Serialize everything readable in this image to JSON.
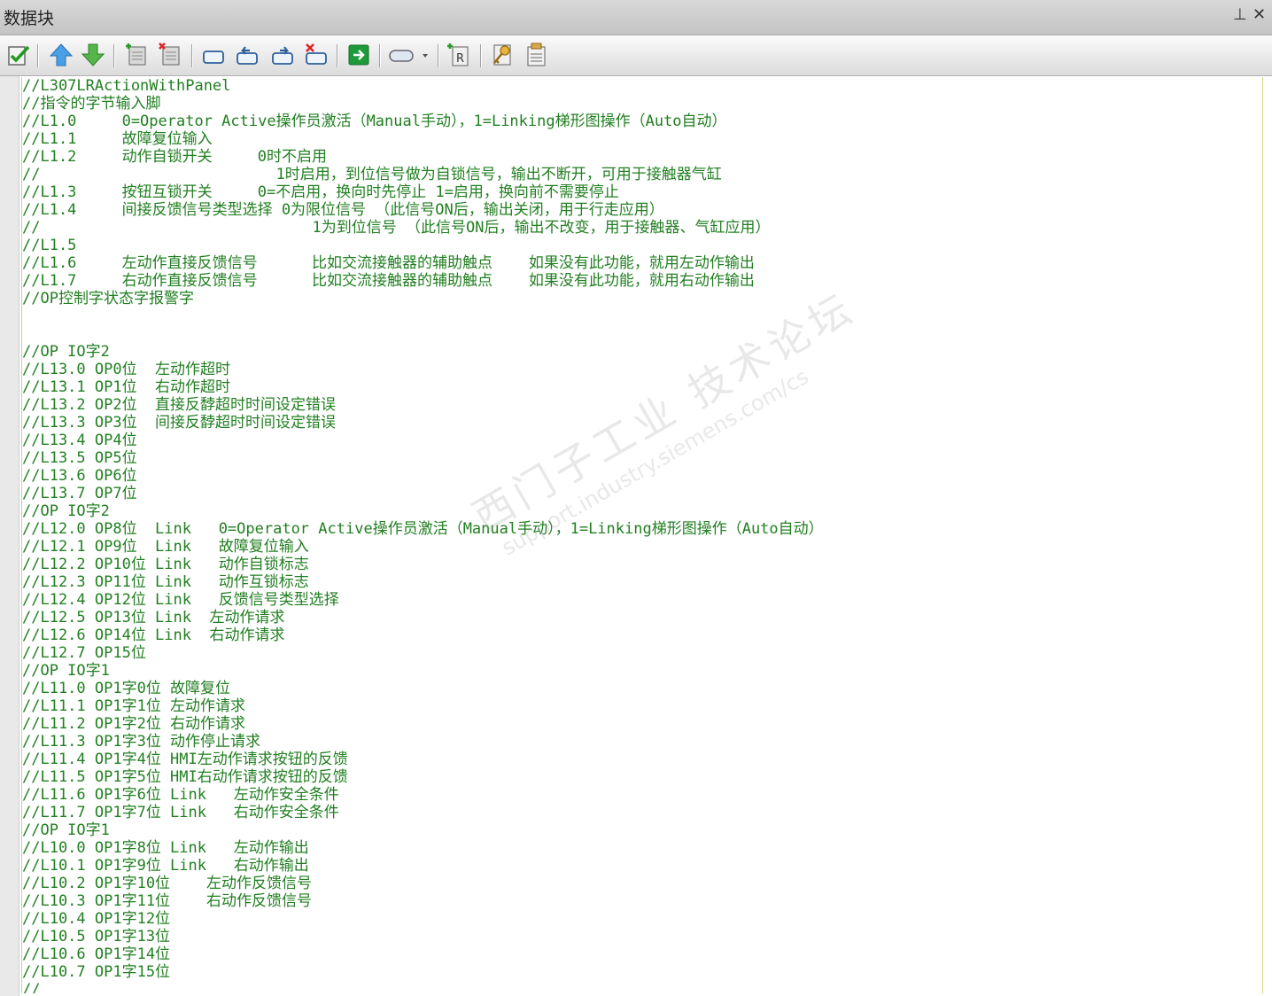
{
  "window": {
    "title": "数据块",
    "pin_glyph": "⊥",
    "close_glyph": "✕"
  },
  "toolbar": {
    "buttons": [
      "check-icon",
      "up-arrow-icon",
      "down-arrow-icon",
      "insert-block-icon",
      "delete-block-icon",
      "rectangle-icon",
      "undo-icon",
      "redo-icon",
      "delete-network-icon",
      "goto-icon",
      "comment-icon",
      "reference-icon",
      "key-icon",
      "properties-icon"
    ]
  },
  "watermark": {
    "line1": "西门子工业  技术论坛",
    "line2": "support.industry.siemens.com/cs"
  },
  "code_lines": [
    "//L307LRActionWithPanel",
    "//指令的字节输入脚",
    "//L1.0     0=Operator Active操作员激活（Manual手动），1=Linking梯形图操作（Auto自动）",
    "//L1.1     故障复位输入",
    "//L1.2     动作自锁开关     0时不启用",
    "//                          1时启用，到位信号做为自锁信号，输出不断开，可用于接触器气缸",
    "//L1.3     按钮互锁开关     0=不启用，换向时先停止 1=启用，换向前不需要停止",
    "//L1.4     间接反馈信号类型选择 0为限位信号 （此信号ON后，输出关闭，用于行走应用）",
    "//                              1为到位信号 （此信号ON后，输出不改变，用于接触器、气缸应用）",
    "//L1.5",
    "//L1.6     左动作直接反馈信号      比如交流接触器的辅助触点    如果没有此功能，就用左动作输出",
    "//L1.7     右动作直接反馈信号      比如交流接触器的辅助触点    如果没有此功能，就用右动作输出",
    "//OP控制字状态字报警字",
    "",
    "",
    "//OP IO字2",
    "//L13.0 OP0位  左动作超时",
    "//L13.1 OP1位  右动作超时",
    "//L13.2 OP2位  直接反馞超时时间设定错误",
    "//L13.3 OP3位  间接反馞超时时间设定错误",
    "//L13.4 OP4位",
    "//L13.5 OP5位",
    "//L13.6 OP6位",
    "//L13.7 OP7位",
    "//OP IO字2",
    "//L12.0 OP8位  Link   0=Operator Active操作员激活（Manual手动），1=Linking梯形图操作（Auto自动）",
    "//L12.1 OP9位  Link   故障复位输入",
    "//L12.2 OP10位 Link   动作自锁标志",
    "//L12.3 OP11位 Link   动作互锁标志",
    "//L12.4 OP12位 Link   反馈信号类型选择",
    "//L12.5 OP13位 Link  左动作请求",
    "//L12.6 OP14位 Link  右动作请求",
    "//L12.7 OP15位",
    "//OP IO字1",
    "//L11.0 OP1字0位 故障复位",
    "//L11.1 OP1字1位 左动作请求",
    "//L11.2 OP1字2位 右动作请求",
    "//L11.3 OP1字3位 动作停止请求",
    "//L11.4 OP1字4位 HMI左动作请求按钮的反馈",
    "//L11.5 OP1字5位 HMI右动作请求按钮的反馈",
    "//L11.6 OP1字6位 Link   左动作安全条件",
    "//L11.7 OP1字7位 Link   右动作安全条件",
    "//OP IO字1",
    "//L10.0 OP1字8位 Link   左动作输出",
    "//L10.1 OP1字9位 Link   右动作输出",
    "//L10.2 OP1字10位    左动作反馈信号",
    "//L10.3 OP1字11位    右动作反馈信号",
    "//L10.4 OP1字12位",
    "//L10.5 OP1字13位",
    "//L10.6 OP1字14位",
    "//L10.7 OP1字15位",
    "//"
  ]
}
